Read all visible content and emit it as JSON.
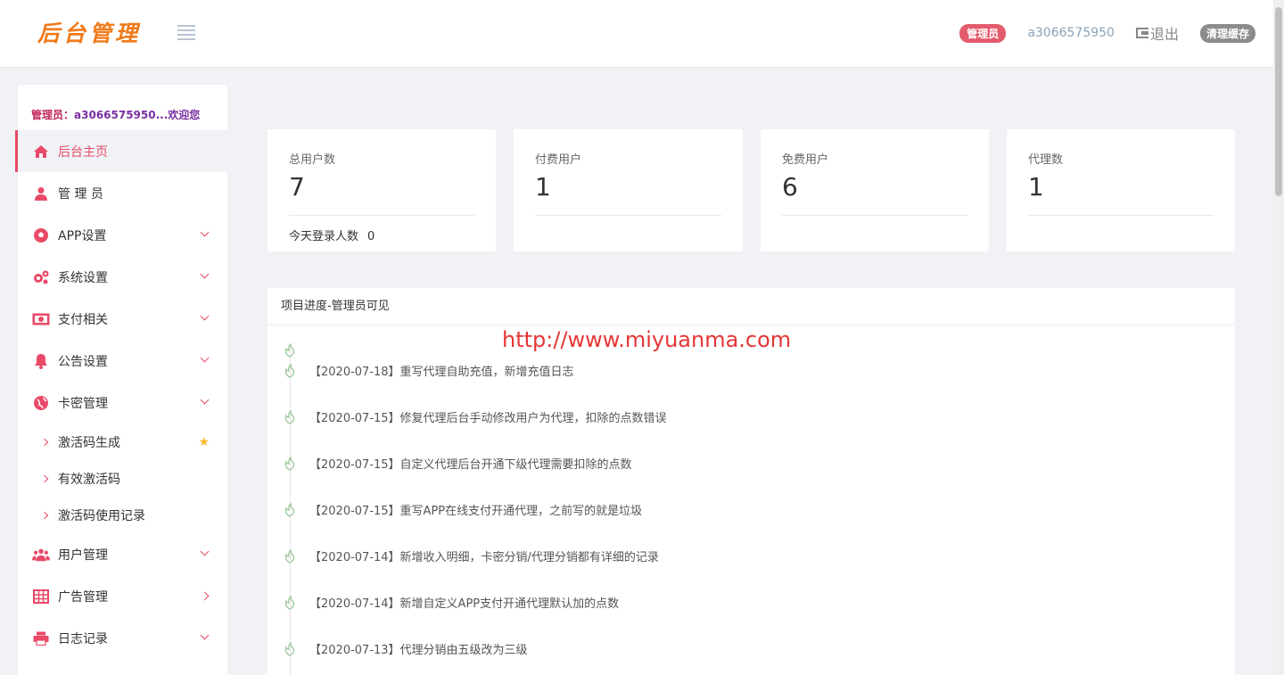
{
  "header": {
    "logo_text": "后台管理",
    "role_badge": "管理员",
    "username": "a3066575950",
    "logout_label": "退出",
    "clear_cache_label": "清理缓存"
  },
  "sidebar": {
    "welcome_prefix": "管理员：",
    "welcome_name": "a3066575950...欢迎您",
    "items": [
      {
        "label": "后台主页",
        "icon": "home-icon",
        "active": true
      },
      {
        "label": "管 理 员",
        "icon": "user-icon"
      },
      {
        "label": "APP设置",
        "icon": "soccer-ball-icon"
      },
      {
        "label": "系统设置",
        "icon": "gears-icon"
      },
      {
        "label": "支付相关",
        "icon": "money-icon"
      },
      {
        "label": "公告设置",
        "icon": "bell-icon"
      },
      {
        "label": "卡密管理",
        "icon": "globe-icon",
        "expanded": true
      },
      {
        "label": "用户管理",
        "icon": "users-icon"
      },
      {
        "label": "广告管理",
        "icon": "table-icon"
      },
      {
        "label": "日志记录",
        "icon": "print-icon"
      }
    ],
    "sub_items": [
      {
        "label": "激活码生成",
        "starred": true
      },
      {
        "label": "有效激活码"
      },
      {
        "label": "激活码使用记录"
      }
    ]
  },
  "stats": [
    {
      "label": "总用户数",
      "value": "7",
      "extra_label": "今天登录人数",
      "extra_value": "0"
    },
    {
      "label": "付费用户",
      "value": "1"
    },
    {
      "label": "免费用户",
      "value": "6"
    },
    {
      "label": "代理数",
      "value": "1"
    }
  ],
  "panel": {
    "title": "项目进度-管理员可见",
    "watermark": "http://www.miyuanma.com",
    "timeline": [
      "【2020-07-18】重写代理自助充值，新增充值日志",
      "【2020-07-15】修复代理后台手动修改用户为代理，扣除的点数错误",
      "【2020-07-15】自定义代理后台开通下级代理需要扣除的点数",
      "【2020-07-15】重写APP在线支付开通代理，之前写的就是垃圾",
      "【2020-07-14】新增收入明细，卡密分销/代理分销都有详细的记录",
      "【2020-07-14】新增自定义APP支付开通代理默认加的点数",
      "【2020-07-13】代理分销由五级改为三级"
    ]
  },
  "colors": {
    "accent": "#e94a67",
    "logo": "#f07a1a",
    "badge_admin": "#e35b6c",
    "watermark": "#e53535"
  }
}
